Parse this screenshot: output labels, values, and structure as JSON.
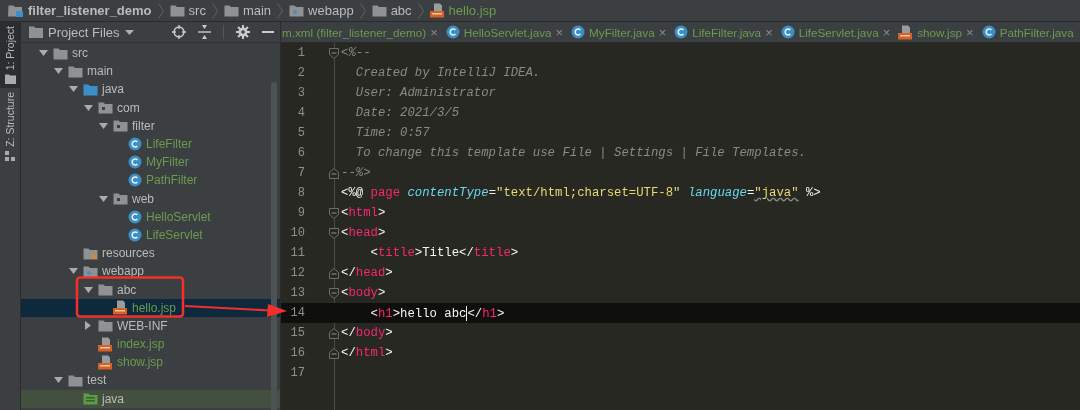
{
  "breadcrumbs": [
    {
      "label": "filter_listener_demo",
      "kind": "module"
    },
    {
      "label": "src",
      "kind": "folder"
    },
    {
      "label": "main",
      "kind": "folder"
    },
    {
      "label": "webapp",
      "kind": "web-root"
    },
    {
      "label": "abc",
      "kind": "folder"
    },
    {
      "label": "hello.jsp",
      "kind": "jsp"
    }
  ],
  "tool_strip": [
    {
      "label": "1: Project",
      "kind": "project",
      "selected": true
    },
    {
      "label": "Z: Structure",
      "kind": "structure",
      "selected": false
    }
  ],
  "project_panel": {
    "title": "Project Files",
    "tree": [
      {
        "label": "src",
        "kind": "folder",
        "expanded": true,
        "selected": false,
        "children": [
          {
            "label": "main",
            "kind": "folder",
            "expanded": true,
            "selected": false,
            "children": [
              {
                "label": "java",
                "kind": "source-root",
                "expanded": true,
                "selected": false,
                "children": [
                  {
                    "label": "com",
                    "kind": "package",
                    "expanded": true,
                    "selected": false,
                    "children": [
                      {
                        "label": "filter",
                        "kind": "package",
                        "expanded": true,
                        "selected": false,
                        "children": [
                          {
                            "label": "LifeFilter",
                            "kind": "class",
                            "selected": false
                          },
                          {
                            "label": "MyFilter",
                            "kind": "class",
                            "selected": false
                          },
                          {
                            "label": "PathFilter",
                            "kind": "class",
                            "selected": false
                          }
                        ]
                      },
                      {
                        "label": "web",
                        "kind": "package",
                        "expanded": true,
                        "selected": false,
                        "children": [
                          {
                            "label": "HelloServlet",
                            "kind": "class",
                            "selected": false
                          },
                          {
                            "label": "LifeServlet",
                            "kind": "class",
                            "selected": false
                          }
                        ]
                      }
                    ]
                  }
                ]
              },
              {
                "label": "resources",
                "kind": "resources-root",
                "selected": false
              },
              {
                "label": "webapp",
                "kind": "web-root",
                "expanded": true,
                "selected": false,
                "children": [
                  {
                    "label": "abc",
                    "kind": "folder",
                    "expanded": true,
                    "selected": false,
                    "children": [
                      {
                        "label": "hello.jsp",
                        "kind": "jsp",
                        "selected": true
                      }
                    ]
                  },
                  {
                    "label": "WEB-INF",
                    "kind": "folder",
                    "expanded": false,
                    "selected": false
                  },
                  {
                    "label": "index.jsp",
                    "kind": "jsp",
                    "selected": false
                  },
                  {
                    "label": "show.jsp",
                    "kind": "jsp",
                    "selected": false
                  }
                ]
              }
            ]
          },
          {
            "label": "test",
            "kind": "folder",
            "expanded": true,
            "selected": false,
            "children": [
              {
                "label": "java",
                "kind": "test-root",
                "selected": false
              }
            ]
          }
        ]
      }
    ]
  },
  "editor_tabs": [
    {
      "label": "m.xml (filter_listener_demo)",
      "kind": "plain",
      "close": "×"
    },
    {
      "label": "HelloServlet.java",
      "kind": "class",
      "close": "×"
    },
    {
      "label": "MyFilter.java",
      "kind": "class",
      "close": "×"
    },
    {
      "label": "LifeFilter.java",
      "kind": "class",
      "close": "×"
    },
    {
      "label": "LifeServlet.java",
      "kind": "class",
      "close": "×"
    },
    {
      "label": "show.jsp",
      "kind": "jsp",
      "close": "×"
    },
    {
      "label": "PathFilter.java",
      "kind": "class"
    }
  ],
  "code": [
    {
      "number": "1",
      "fold_start": true,
      "fold_end": false,
      "current": false,
      "tokens": [
        {
          "kind": "comment",
          "text": "<%--"
        }
      ]
    },
    {
      "number": "2",
      "fold_start": false,
      "fold_end": false,
      "current": false,
      "tokens": [
        {
          "kind": "comment",
          "text": "  Created by IntelliJ IDEA."
        }
      ]
    },
    {
      "number": "3",
      "fold_start": false,
      "fold_end": false,
      "current": false,
      "tokens": [
        {
          "kind": "comment",
          "text": "  User: Administrator"
        }
      ]
    },
    {
      "number": "4",
      "fold_start": false,
      "fold_end": false,
      "current": false,
      "tokens": [
        {
          "kind": "comment",
          "text": "  Date: 2021/3/5"
        }
      ]
    },
    {
      "number": "5",
      "fold_start": false,
      "fold_end": false,
      "current": false,
      "tokens": [
        {
          "kind": "comment",
          "text": "  Time: 0:57"
        }
      ]
    },
    {
      "number": "6",
      "fold_start": false,
      "fold_end": false,
      "current": false,
      "tokens": [
        {
          "kind": "comment",
          "text": "  To change this template use File | Settings | File Templates."
        }
      ]
    },
    {
      "number": "7",
      "fold_start": false,
      "fold_end": true,
      "current": false,
      "tokens": [
        {
          "kind": "comment",
          "text": "--%>"
        }
      ]
    },
    {
      "number": "8",
      "fold_start": false,
      "fold_end": false,
      "current": false,
      "tokens": [
        {
          "kind": "plain",
          "text": "<%@ "
        },
        {
          "kind": "keyword",
          "text": "page"
        },
        {
          "kind": "attribute",
          "text": " contentType"
        },
        {
          "kind": "plain",
          "text": "="
        },
        {
          "kind": "string",
          "text": "\"text/html;charset=UTF-8\""
        },
        {
          "kind": "attribute",
          "text": " language"
        },
        {
          "kind": "plain",
          "text": "="
        },
        {
          "kind": "string",
          "text": "\"java\"",
          "warning": true
        },
        {
          "kind": "plain",
          "text": " %>"
        }
      ]
    },
    {
      "number": "9",
      "fold_start": true,
      "fold_end": false,
      "current": false,
      "tokens": [
        {
          "kind": "plain",
          "text": "<"
        },
        {
          "kind": "tag",
          "text": "html"
        },
        {
          "kind": "plain",
          "text": ">"
        }
      ]
    },
    {
      "number": "10",
      "fold_start": true,
      "fold_end": false,
      "current": false,
      "tokens": [
        {
          "kind": "plain",
          "text": "<"
        },
        {
          "kind": "tag",
          "text": "head"
        },
        {
          "kind": "plain",
          "text": ">"
        }
      ]
    },
    {
      "number": "11",
      "fold_start": false,
      "fold_end": false,
      "current": false,
      "tokens": [
        {
          "kind": "plain",
          "text": "    <"
        },
        {
          "kind": "tag",
          "text": "title"
        },
        {
          "kind": "plain",
          "text": ">Title</"
        },
        {
          "kind": "tag",
          "text": "title"
        },
        {
          "kind": "plain",
          "text": ">"
        }
      ]
    },
    {
      "number": "12",
      "fold_start": false,
      "fold_end": true,
      "current": false,
      "tokens": [
        {
          "kind": "plain",
          "text": "</"
        },
        {
          "kind": "tag",
          "text": "head"
        },
        {
          "kind": "plain",
          "text": ">"
        }
      ]
    },
    {
      "number": "13",
      "fold_start": true,
      "fold_end": false,
      "current": false,
      "tokens": [
        {
          "kind": "plain",
          "text": "<"
        },
        {
          "kind": "tag",
          "text": "body"
        },
        {
          "kind": "plain",
          "text": ">"
        }
      ]
    },
    {
      "number": "14",
      "fold_start": false,
      "fold_end": false,
      "current": true,
      "tokens": [
        {
          "kind": "plain",
          "text": "    <"
        },
        {
          "kind": "tag",
          "text": "h1"
        },
        {
          "kind": "plain",
          "text": ">hello abc"
        },
        {
          "kind": "caret"
        },
        {
          "kind": "plain",
          "text": "</"
        },
        {
          "kind": "tag",
          "text": "h1"
        },
        {
          "kind": "plain",
          "text": ">"
        }
      ]
    },
    {
      "number": "15",
      "fold_start": false,
      "fold_end": true,
      "current": false,
      "tokens": [
        {
          "kind": "plain",
          "text": "</"
        },
        {
          "kind": "tag",
          "text": "body"
        },
        {
          "kind": "plain",
          "text": ">"
        }
      ]
    },
    {
      "number": "16",
      "fold_start": false,
      "fold_end": true,
      "current": false,
      "tokens": [
        {
          "kind": "plain",
          "text": "</"
        },
        {
          "kind": "tag",
          "text": "html"
        },
        {
          "kind": "plain",
          "text": ">"
        }
      ]
    },
    {
      "number": "17",
      "fold_start": false,
      "fold_end": false,
      "current": false
    }
  ],
  "annotations": {
    "highlight_box": true,
    "arrow": true
  }
}
